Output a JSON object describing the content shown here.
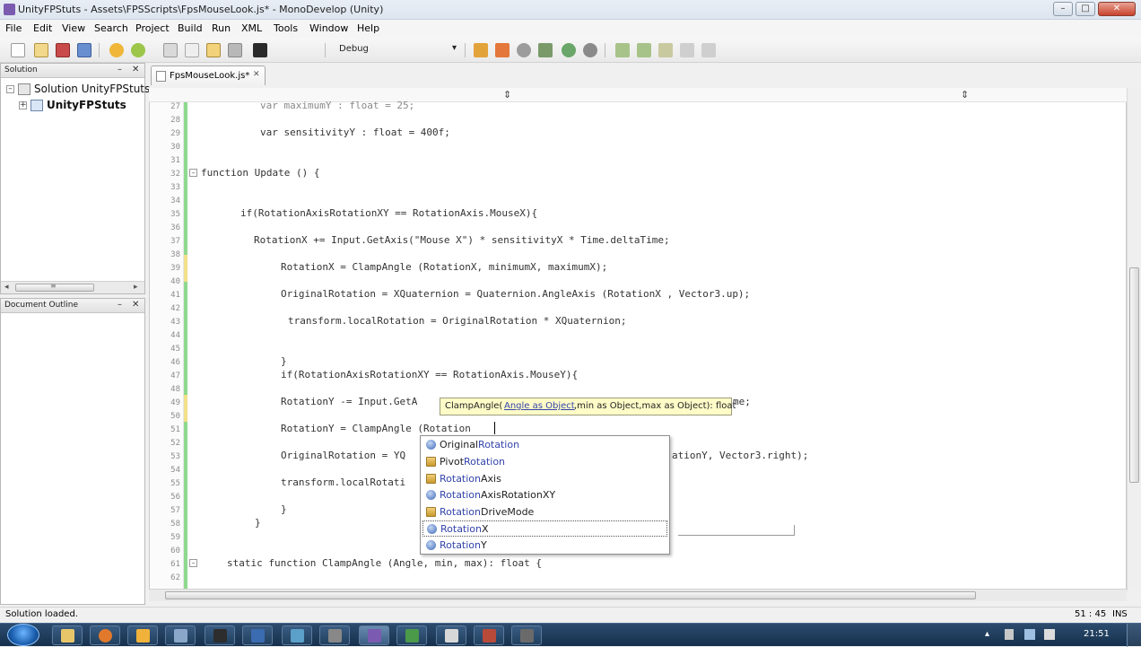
{
  "window": {
    "title": "UnityFPStuts - Assets\\FPSScripts\\FpsMouseLook.js* - MonoDevelop (Unity)",
    "controls": [
      "–",
      "□",
      "✕"
    ]
  },
  "menu": [
    "File",
    "Edit",
    "View",
    "Search",
    "Project",
    "Build",
    "Run",
    "XML",
    "Tools",
    "Window",
    "Help"
  ],
  "toolbar": {
    "config_label": "Debug",
    "dropdown_arrow": "▾"
  },
  "solution_pad": {
    "title": "Solution",
    "pin": "–",
    "close": "✕",
    "root": {
      "expander": "–",
      "label": "Solution UnityFPStuts"
    },
    "child": {
      "expander": "+",
      "label": "UnityFPStuts"
    },
    "scroll_left": "◂",
    "scroll_thumb": "≡",
    "scroll_right": "▸"
  },
  "outline_pad": {
    "title": "Document Outline",
    "pin": "–",
    "close": "✕"
  },
  "tab": {
    "label": "FpsMouseLook.js*",
    "close": "✕"
  },
  "editor_head": {
    "left_arrows": "⇕",
    "right_arrows": "⇕"
  },
  "code": {
    "line_numbers": [
      "27",
      "28",
      "29",
      "30",
      "31",
      "32",
      "33",
      "34",
      "35",
      "36",
      "37",
      "38",
      "39",
      "40",
      "41",
      "42",
      "43",
      "44",
      "45",
      "46",
      "47",
      "48",
      "49",
      "50",
      "51",
      "52",
      "53",
      "54",
      "55",
      "56",
      "57",
      "58",
      "59",
      "60",
      "61",
      "62"
    ],
    "fold_markers": {
      "function": "–",
      "static": "–"
    },
    "lines": {
      "l27": "var maximumY : float = 25;",
      "l29": "var sensitivityY : float = 400f;",
      "l32": "function Update () {",
      "l35": "if(RotationAxisRotationXY == RotationAxis.MouseX){",
      "l37": "RotationX += Input.GetAxis(\"Mouse X\") * sensitivityX * Time.deltaTime;",
      "l39": "RotationX = ClampAngle (RotationX, minimumX, maximumX);",
      "l41": "OriginalRotation = XQuaternion = Quaternion.AngleAxis (RotationX , Vector3.up);",
      "l43": "transform.localRotation = OriginalRotation * XQuaternion;",
      "l46": "}",
      "l47": "if(RotationAxisRotationXY == RotationAxis.MouseY){",
      "l49_a": "RotationY -= Input.GetA",
      "l49_b": "me;",
      "l51": "RotationY = ClampAngle (Rotation",
      "l53_a": "OriginalRotation = YQ",
      "l53_b": "ationY, Vector3.right);",
      "l55": "transform.localRotati",
      "l57": "}",
      "l58": "}",
      "l61": "static function ClampAngle (Angle, min, max): float {"
    }
  },
  "tooltip": {
    "prefix": "ClampAngle(",
    "current_param": "Angle as Object",
    "rest": ",min as Object,max as Object): float"
  },
  "completion": {
    "items": [
      {
        "pre": "Original",
        "match": "Rotation",
        "post": "",
        "icon": "field-icon"
      },
      {
        "pre": "Pivot",
        "match": "Rotation",
        "post": "",
        "icon": "class-icon"
      },
      {
        "pre": "",
        "match": "Rotation",
        "post": "Axis",
        "icon": "class-icon"
      },
      {
        "pre": "",
        "match": "Rotation",
        "post": "AxisRotationXY",
        "icon": "field-icon"
      },
      {
        "pre": "",
        "match": "Rotation",
        "post": "DriveMode",
        "icon": "class-icon"
      },
      {
        "pre": "",
        "match": "Rotation",
        "post": "X",
        "icon": "field-icon",
        "selected": true
      },
      {
        "pre": "",
        "match": "Rotation",
        "post": "Y",
        "icon": "field-icon"
      }
    ]
  },
  "status": {
    "message": "Solution loaded.",
    "position": "51 : 45",
    "mode": "INS"
  },
  "taskbar": {
    "clock": "21:51",
    "tray_arrow": "▴"
  }
}
